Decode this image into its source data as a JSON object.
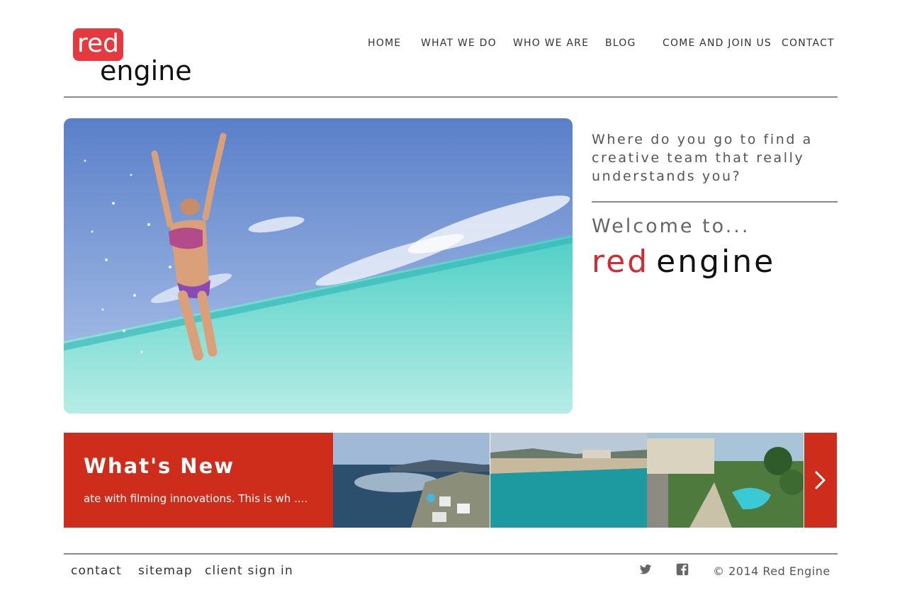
{
  "logo": {
    "red": "red",
    "engine": "engine"
  },
  "nav": {
    "items": [
      {
        "label": "HOME"
      },
      {
        "label": "WHAT WE DO"
      },
      {
        "label": "WHO WE ARE"
      },
      {
        "label": "BLOG"
      },
      {
        "label": "COME AND JOIN US"
      },
      {
        "label": "CONTACT"
      }
    ]
  },
  "hero": {
    "tagline": "Where do you go to find a creative team that really understands you?",
    "welcome": "Welcome to...",
    "brand_red": "red",
    "brand_black": "engine"
  },
  "news": {
    "title": "What's New",
    "ticker": "ate with filming innovations. This is wh ....",
    "next_icon": "chevron-right-icon"
  },
  "footer": {
    "links": [
      "contact",
      "sitemap",
      "client sign in"
    ],
    "social_icons": [
      "twitter-icon",
      "facebook-icon"
    ],
    "copyright": "© 2014 Red Engine"
  },
  "colors": {
    "brand_red": "#e23a3e",
    "strip_red": "#cf2d1c",
    "rule_gray": "#8a8a8a"
  }
}
